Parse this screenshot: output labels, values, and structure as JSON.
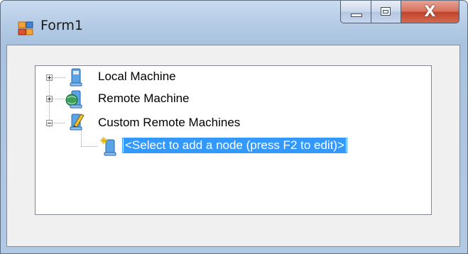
{
  "window": {
    "title": "Form1",
    "icon": "form-app-icon",
    "controls": {
      "minimize": "minimize-icon",
      "maximize": "maximize-icon",
      "close_label": "X"
    }
  },
  "tree": {
    "nodes": [
      {
        "label": "Local Machine",
        "icon": "computer-icon",
        "expanded": false,
        "level": 0
      },
      {
        "label": "Remote Machine",
        "icon": "globe-computer-icon",
        "expanded": false,
        "level": 0
      },
      {
        "label": "Custom Remote Machines",
        "icon": "pencil-computer-icon",
        "expanded": true,
        "level": 0
      },
      {
        "label": "<Select to add a node (press F2 to edit)>",
        "icon": "add-computer-icon",
        "level": 1,
        "selected": true,
        "editing": true
      }
    ]
  },
  "colors": {
    "selection": "#3399ff",
    "tree_background": "#ffffff",
    "client_background": "#f0f0f0",
    "close_button": "#c0432a"
  }
}
